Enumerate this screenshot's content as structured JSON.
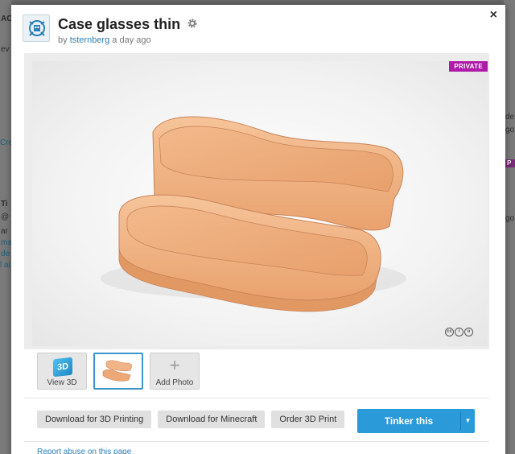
{
  "background": {
    "fragments": [
      "AC",
      "ev",
      "Cre",
      "Ti",
      "@",
      "ar",
      "ma",
      "de",
      "l ai",
      "de",
      "go",
      "go",
      "P"
    ]
  },
  "modal": {
    "title": "Case glasses thin",
    "by_prefix": "by",
    "author": "tsternberg",
    "time": "a day ago",
    "close_label": "×",
    "private_label": "PRIVATE",
    "license_icons": [
      "cc-icon",
      "attribution-icon",
      "share-alike-icon"
    ],
    "thumbnails": [
      {
        "label": "View 3D",
        "icon": "view-3d-icon",
        "icon_text": "3D"
      },
      {
        "label": "",
        "icon": "model-thumbnail"
      },
      {
        "label": "Add Photo",
        "icon": "plus-icon",
        "icon_text": "+"
      }
    ],
    "actions": {
      "download_3d": "Download for 3D Printing",
      "download_minecraft": "Download for Minecraft",
      "order_print": "Order 3D Print",
      "tinker": "Tinker this"
    },
    "report": "Report abuse on this page"
  },
  "colors": {
    "accent": "#2a9ad9",
    "private_badge": "#b01aa8",
    "model": "#f2b483",
    "link": "#2a7fb8"
  }
}
